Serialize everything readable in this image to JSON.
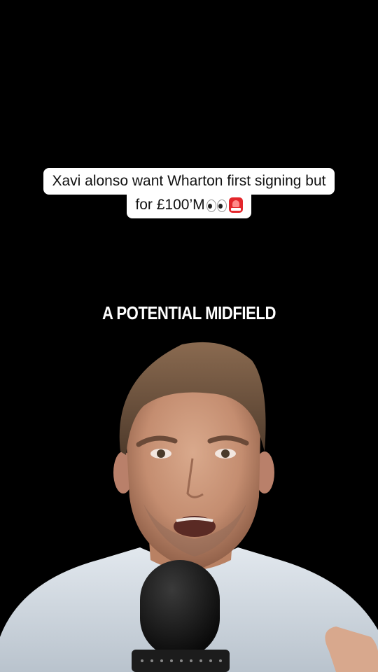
{
  "caption": {
    "line1": "Xavi alonso want Wharton first signing but",
    "line2": "for £100’M",
    "emojis": [
      "eyes-icon",
      "siren-icon"
    ]
  },
  "overlay": {
    "headline": "A POTENTIAL MIDFIELD"
  },
  "colors": {
    "background": "#000000",
    "caption_bg": "#ffffff",
    "caption_text": "#111111",
    "headline_text": "#ffffff",
    "shirt": "#cfd7e0",
    "microphone": "#141414"
  }
}
